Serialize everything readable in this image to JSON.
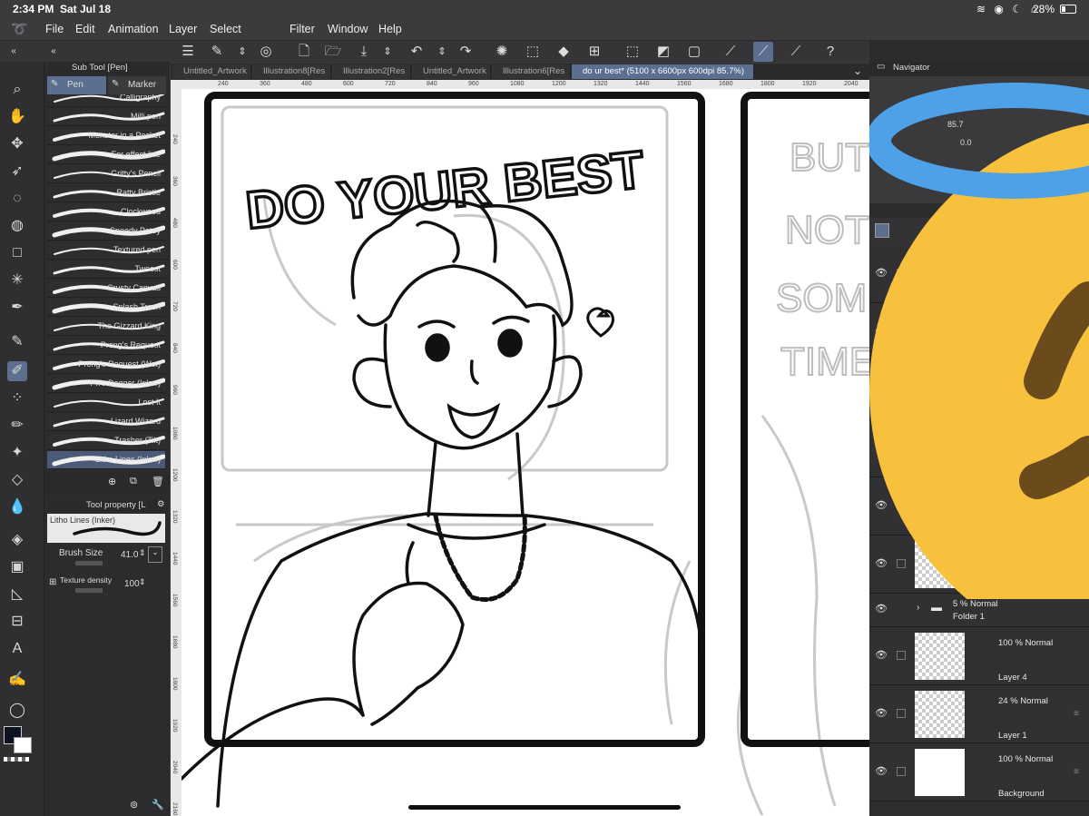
{
  "status": {
    "time": "2:34 PM",
    "date": "Sat Jul 18",
    "battery": "28%"
  },
  "menu": [
    "File",
    "Edit",
    "Animation",
    "Layer",
    "Select",
    "Filter",
    "Window",
    "Help"
  ],
  "subtool": {
    "title": "Sub Tool [Pen]",
    "tabs": [
      "Pen",
      "Marker"
    ],
    "brushes": [
      "Calligraphy",
      "Milli pen",
      "Monster in a Pocket",
      "For effect line",
      "Gritty's Pencil",
      "Ratty Bristle",
      "Clockwood",
      "Speedy Petey",
      "Textured pen",
      "Tweest",
      "Crusty Canvas",
      "Splash Trash",
      "The Gizzard King",
      "Prong's Request",
      "Prong's Request (Wet)",
      "Pri's Dagger (Inker)",
      "Lost It",
      "Lizard Wizard",
      "Trasher (Tilt)",
      "Litho Lines (Inker)"
    ]
  },
  "toolprop": {
    "title": "Tool property [L",
    "brush_name": "Litho Lines (Inker)",
    "size_label": "Brush Size",
    "size_value": "41.0",
    "texture_label": "Texture density",
    "texture_value": "100"
  },
  "tabs": [
    "Untitled_Artwork",
    "Illustration8[Res",
    "Illustration2[Res",
    "Untitled_Artwork",
    "Illustration6[Res",
    "do ur best* (5100 x 6600px 600dpi 85.7%)"
  ],
  "ruler": {
    "h": [
      "240",
      "360",
      "480",
      "600",
      "720",
      "840",
      "960",
      "1080",
      "1200",
      "1320",
      "1440",
      "1560",
      "1680",
      "1800",
      "1920",
      "2040"
    ],
    "v": [
      "240",
      "360",
      "480",
      "600",
      "720",
      "840",
      "960",
      "1080",
      "1200",
      "1320",
      "1440",
      "1560",
      "1680",
      "1800",
      "1920",
      "2040",
      "2160"
    ]
  },
  "canvas_text": {
    "title": "DO YOUR BEST",
    "side": [
      "BUT",
      "NOT",
      "SOME",
      "TIME"
    ]
  },
  "navigator": {
    "title": "Navigator",
    "zoom": "85.7",
    "rotation": "0.0"
  },
  "layers": [
    {
      "mode": "5 % Normal",
      "name": "Folder 1",
      "folder": true
    },
    {
      "mode": "100 % Normal",
      "name": "Layer 4"
    },
    {
      "mode": "24 % Normal",
      "name": "Layer 1"
    },
    {
      "mode": "100 % Normal",
      "name": "Background"
    }
  ],
  "colors": {
    "accent": "#5c6f8e",
    "emoji": "#f7c13d",
    "halo": "#4ea1e6"
  }
}
